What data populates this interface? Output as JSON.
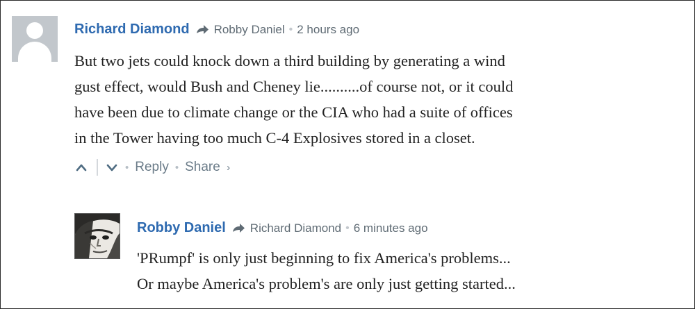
{
  "comments": [
    {
      "author": "Richard Diamond",
      "in_reply_to": "Robby Daniel",
      "separator": "•",
      "time": "2 hours ago",
      "body_lines": [
        "But two jets could knock down a third building by generating a wind",
        "gust effect, would Bush and Cheney lie..........of course not, or it could",
        "have been due to climate change or the CIA who had a suite of offices",
        "in the Tower having too much C-4 Explosives stored in a closet."
      ],
      "actions": {
        "reply_label": "Reply",
        "share_label": "Share",
        "share_chevron": "›",
        "separator": "•"
      }
    },
    {
      "author": "Robby Daniel",
      "in_reply_to": "Richard Diamond",
      "separator": "•",
      "time": "6 minutes ago",
      "body_lines": [
        "'PRumpf' is only just beginning to fix America's problems...",
        "Or maybe America's problem's are only just getting started..."
      ]
    }
  ],
  "colors": {
    "author": "#2e6ab0",
    "meta": "#5f6b74",
    "body": "#222222",
    "actions": "#4f6c82",
    "avatar_placeholder": "#c2c7cc"
  },
  "icons": {
    "default_avatar": "user-silhouette-icon",
    "reply_arrow": "reply-arrow-icon",
    "upvote": "chevron-up-icon",
    "downvote": "chevron-down-icon"
  }
}
